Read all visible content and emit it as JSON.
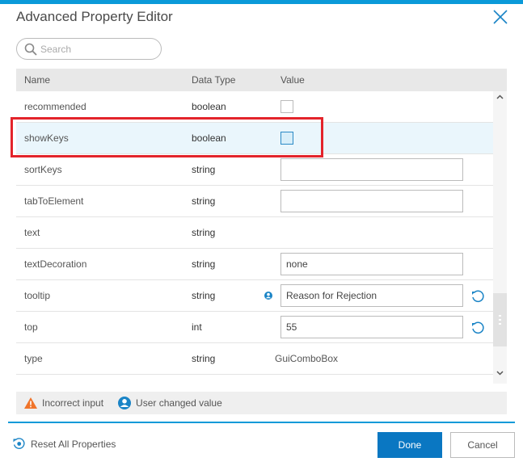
{
  "dialog": {
    "title": "Advanced Property Editor",
    "close_icon": "close-icon"
  },
  "search": {
    "placeholder": "Search",
    "value": "",
    "icon": "search-icon"
  },
  "grid": {
    "columns": [
      "Name",
      "Data Type",
      "Value"
    ],
    "rows": [
      {
        "name": "recommended",
        "type": "boolean",
        "editor": "checkbox",
        "value": false
      },
      {
        "name": "showKeys",
        "type": "boolean",
        "editor": "checkbox",
        "value": false,
        "selected": true
      },
      {
        "name": "sortKeys",
        "type": "string",
        "editor": "text",
        "value": ""
      },
      {
        "name": "tabToElement",
        "type": "string",
        "editor": "text",
        "value": ""
      },
      {
        "name": "text",
        "type": "string",
        "editor": "none",
        "value": ""
      },
      {
        "name": "textDecoration",
        "type": "string",
        "editor": "text",
        "value": "none"
      },
      {
        "name": "tooltip",
        "type": "string",
        "editor": "text",
        "value": "Reason for Rejection",
        "user_changed": true,
        "revertible": true
      },
      {
        "name": "top",
        "type": "int",
        "editor": "text",
        "value": "55",
        "revertible": true
      },
      {
        "name": "type",
        "type": "string",
        "editor": "readonly",
        "value": "GuiComboBox"
      }
    ],
    "scroll_position_fraction": 0.8
  },
  "legend": {
    "incorrect_input": "Incorrect input",
    "user_changed": "User changed value"
  },
  "footer": {
    "reset_label": "Reset All Properties",
    "done_label": "Done",
    "cancel_label": "Cancel"
  },
  "colors": {
    "accent": "#0a9ad9",
    "primary_button": "#0a77c2",
    "highlight_box": "#e3242b",
    "warning": "#f0742a",
    "selected_row": "#eaf6fc"
  }
}
